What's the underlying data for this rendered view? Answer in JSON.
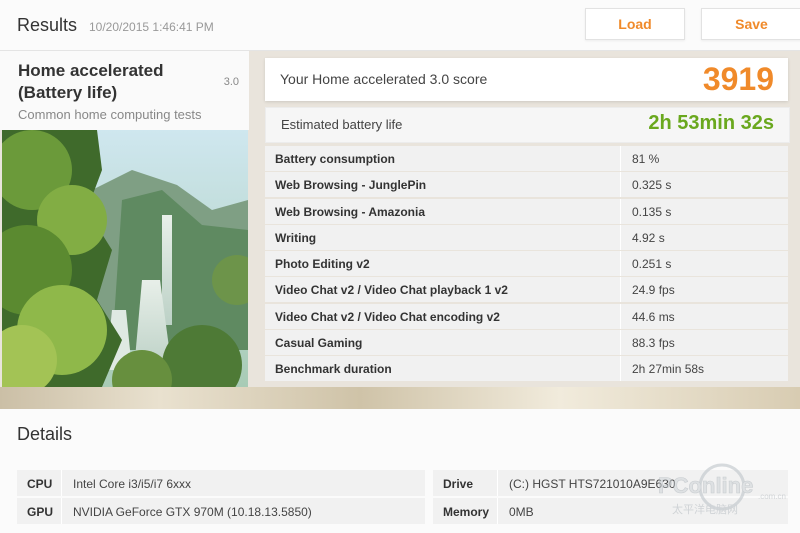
{
  "header": {
    "title": "Results",
    "timestamp": "10/20/2015 1:46:41 PM",
    "load_label": "Load",
    "save_label": "Save"
  },
  "test": {
    "name": "Home accelerated (Battery life)",
    "version": "3.0",
    "description": "Common home computing tests"
  },
  "score": {
    "label": "Your Home accelerated 3.0 score",
    "value": "3919"
  },
  "battery": {
    "label": "Estimated battery life",
    "value": "2h 53min 32s"
  },
  "metrics": [
    {
      "name": "Battery consumption",
      "value": "81 %"
    },
    {
      "name": "Web Browsing - JunglePin",
      "value": "0.325 s"
    },
    {
      "name": "Web Browsing - Amazonia",
      "value": "0.135 s"
    },
    {
      "name": "Writing",
      "value": "4.92 s"
    },
    {
      "name": "Photo Editing v2",
      "value": "0.251 s"
    },
    {
      "name": "Video Chat v2 / Video Chat playback 1 v2",
      "value": "24.9 fps"
    },
    {
      "name": "Video Chat v2 / Video Chat encoding v2",
      "value": "44.6 ms"
    },
    {
      "name": "Casual Gaming",
      "value": "88.3 fps"
    },
    {
      "name": "Benchmark duration",
      "value": "2h 27min 58s"
    }
  ],
  "details": {
    "title": "Details",
    "cpu_label": "CPU",
    "cpu_value": "Intel Core i3/i5/i7 6xxx",
    "gpu_label": "GPU",
    "gpu_value": "NVIDIA GeForce GTX 970M (10.18.13.5850)",
    "drive_label": "Drive",
    "drive_value": "(C:) HGST HTS721010A9E630",
    "memory_label": "Memory",
    "memory_value": "0MB"
  },
  "watermark": {
    "brand": "PConline",
    "domain": ".com.cn",
    "tagline": "太平洋电脑网"
  },
  "colors": {
    "accent_orange": "#f08a2a",
    "battery_green": "#6aa81e",
    "row_bg": "#f1f1f1"
  }
}
